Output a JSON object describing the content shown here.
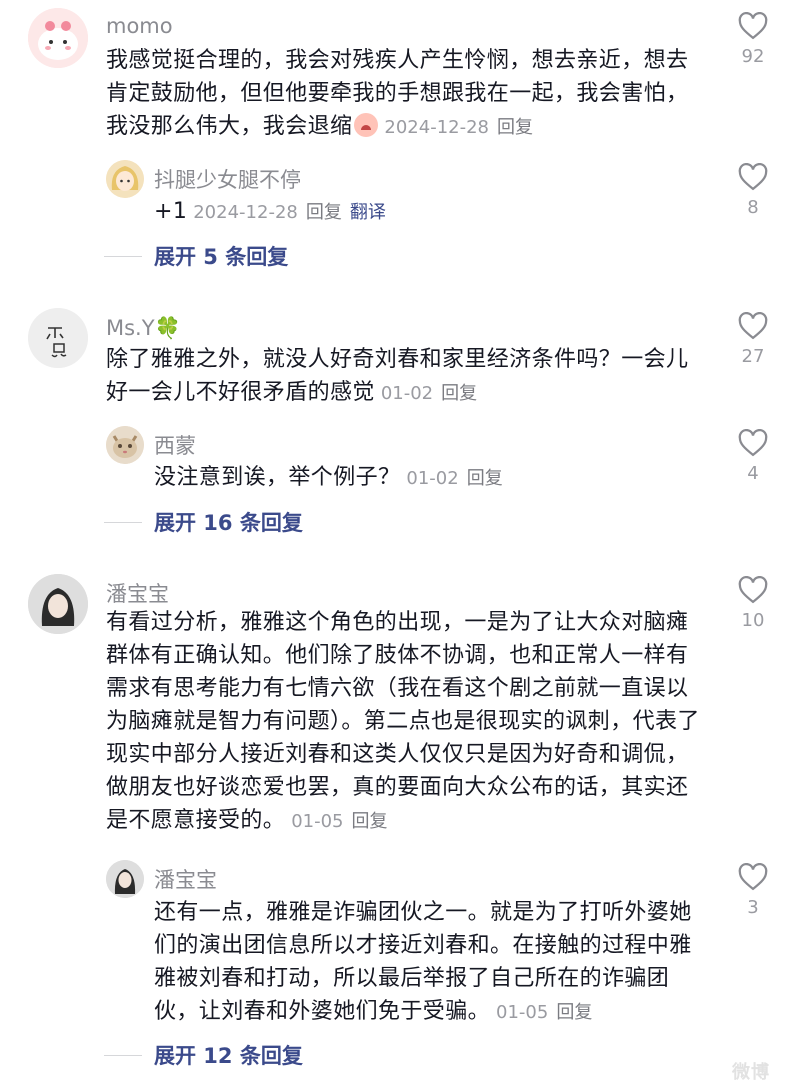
{
  "comments": [
    {
      "user": "momo",
      "text": "我感觉挺合理的，我会对残疾人产生怜悯，想去亲近，想去肯定鼓励他，但但他要牵我的手想跟我在一起，我会害怕，我没那么伟大，我会退缩",
      "emoji": "crying-face",
      "date": "2024-12-28",
      "reply_label": "回复",
      "likes": "92",
      "reply": {
        "user": "抖腿少女腿不停",
        "text": "+1",
        "date": "2024-12-28",
        "reply_label": "回复",
        "translate_label": "翻译",
        "likes": "8"
      },
      "expand": "展开 5 条回复"
    },
    {
      "user": "Ms.Y🍀",
      "text": "除了雅雅之外，就没人好奇刘春和家里经济条件吗？一会儿好一会儿不好很矛盾的感觉",
      "date": "01-02",
      "reply_label": "回复",
      "likes": "27",
      "reply": {
        "user": "西蒙",
        "text": "没注意到诶，举个例子？",
        "date": "01-02",
        "reply_label": "回复",
        "likes": "4"
      },
      "expand": "展开 16 条回复"
    },
    {
      "user": "潘宝宝",
      "text": "有看过分析，雅雅这个角色的出现，一是为了让大众对脑瘫群体有正确认知。他们除了肢体不协调，也和正常人一样有需求有思考能力有七情六欲（我在看这个剧之前就一直误以为脑瘫就是智力有问题）。第二点也是很现实的讽刺，代表了现实中部分人接近刘春和这类人仅仅只是因为好奇和调侃，做朋友也好谈恋爱也罢，真的要面向大众公布的话，其实还是不愿意接受的。",
      "date": "01-05",
      "reply_label": "回复",
      "likes": "10",
      "reply": {
        "user": "潘宝宝",
        "text": "还有一点，雅雅是诈骗团伙之一。就是为了打听外婆她们的演出团信息所以才接近刘春和。在接触的过程中雅雅被刘春和打动，所以最后举报了自己所在的诈骗团伙，让刘春和外婆她们免于受骗。",
        "date": "01-05",
        "reply_label": "回复",
        "likes": "3"
      },
      "expand": "展开 12 条回复"
    }
  ],
  "watermark": "微博",
  "colors": {
    "link": "#3b4a8b",
    "muted": "#9a9ba1",
    "text": "#161823"
  }
}
